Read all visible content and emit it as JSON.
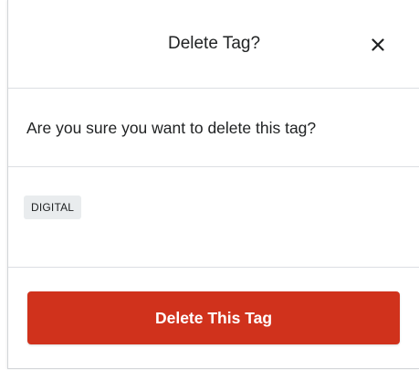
{
  "dialog": {
    "title": "Delete Tag?",
    "close_icon": "close-icon",
    "message": "Are you sure you want to delete this tag?",
    "tag_label": "DIGITAL",
    "delete_button_label": "Delete This Tag"
  },
  "colors": {
    "danger": "#d0321c",
    "tag_background": "#e9ecee",
    "divider": "#dcdfe3",
    "text": "#202223"
  }
}
